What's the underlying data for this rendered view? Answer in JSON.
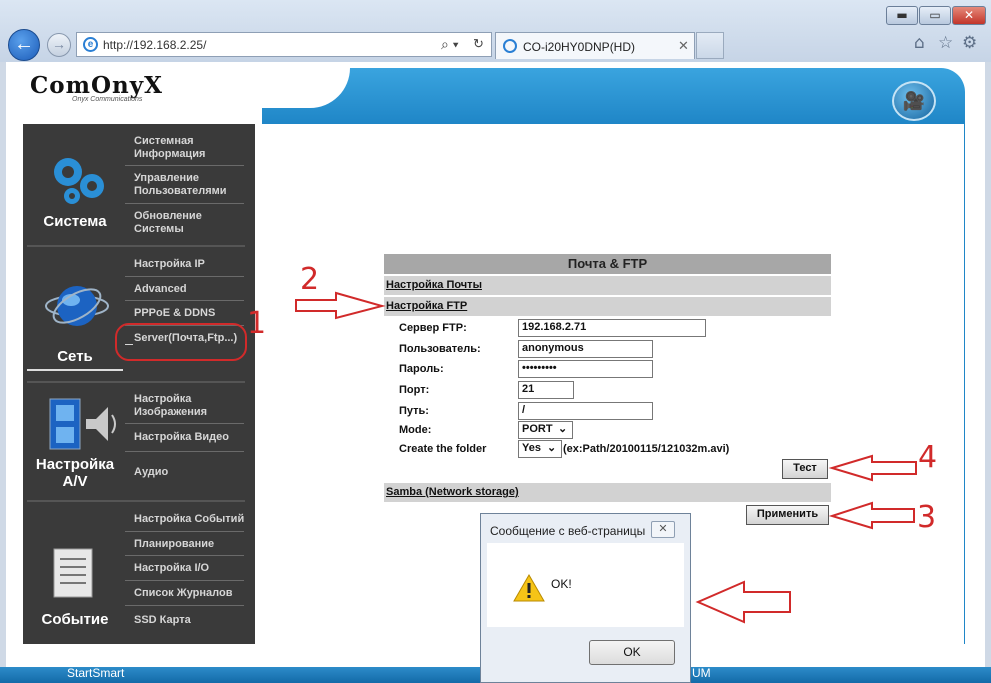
{
  "browser": {
    "window_buttons": {
      "minimize": "▬",
      "maximize": "▭",
      "close": "✕"
    },
    "address": "http://192.168.2.25/",
    "address_search_icon": "⌕ ▾",
    "address_refresh_icon": "↻",
    "tab_title": "CO-i20HY0DNP(HD)",
    "tab_close": "✕",
    "toolbar_icons": [
      "home-icon",
      "star-icon",
      "gear-icon"
    ]
  },
  "logo": {
    "text": "ComOnyX",
    "subtitle": "Onyx Communications"
  },
  "sidebar": {
    "sections": [
      {
        "label": "Система",
        "items": [
          "Системная Информация",
          "Управление Пользователями",
          "Обновление Системы"
        ]
      },
      {
        "label": "Сеть",
        "items": [
          "Настройка IP",
          "Advanced",
          "PPPoE & DDNS",
          "Server(Почта,Ftp...)"
        ]
      },
      {
        "label": "Настройка A/V",
        "items": [
          "Настройка Изображения",
          "Настройка Видео",
          "Аудио"
        ]
      },
      {
        "label": "Событие",
        "items": [
          "Настройка Событий",
          "Планирование",
          "Настройка I/O",
          "Список Журналов",
          "SSD Карта"
        ]
      }
    ]
  },
  "panel": {
    "title": "Почта & FTP",
    "mail_link": "Настройка Почты",
    "ftp_link": "Настройка FTP",
    "fields": {
      "server_label": "Сервер FTP:",
      "server_value": "192.168.2.71",
      "user_label": "Пользователь:",
      "user_value": "anonymous",
      "password_label": "Пароль:",
      "password_value": "•••••••••",
      "port_label": "Порт:",
      "port_value": "21",
      "path_label": "Путь:",
      "path_value": "/",
      "mode_label": "Mode:",
      "mode_value": "PORT",
      "folder_label": "Create the folder",
      "folder_value": "Yes",
      "folder_hint": "(ex:Path/20100115/121032m.avi)"
    },
    "test_button": "Тест",
    "samba_link": "Samba (Network storage)",
    "apply_button": "Применить"
  },
  "annotations": {
    "n1": "1",
    "n2": "2",
    "n3": "3",
    "n4": "4"
  },
  "dialog": {
    "title": "Сообщение с веб-страницы",
    "close": "✕",
    "message": "OK!",
    "ok_button": "OK"
  },
  "taskbar": {
    "left_text": "StartSmart",
    "right_text": "UM"
  },
  "colors": {
    "accent": "#1f86c7",
    "sidebar": "#3a3a3a",
    "annotation": "#d12a2a"
  }
}
